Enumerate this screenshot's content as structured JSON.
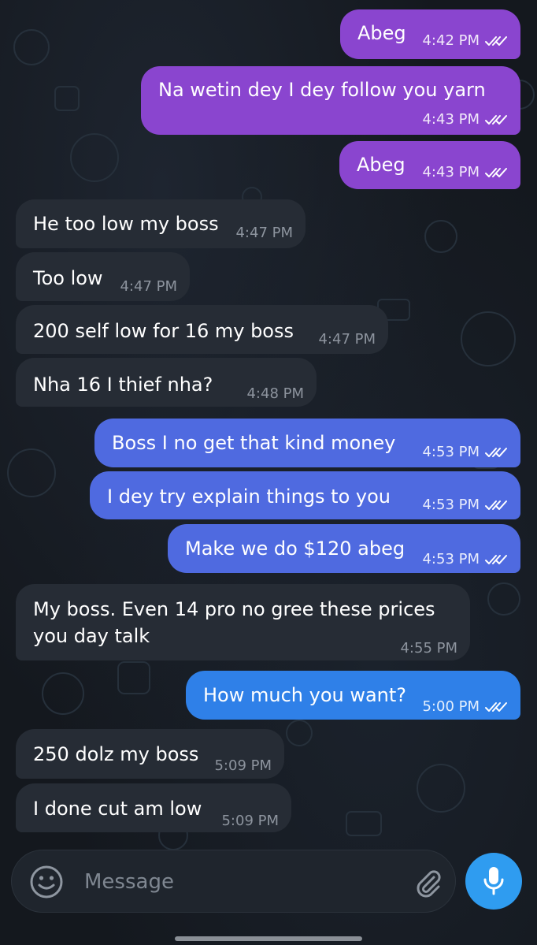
{
  "theme": {
    "outgoing_purple": "#8a45cf",
    "outgoing_blue": "#4f6ae0",
    "outgoing_sky": "#2f80e8",
    "incoming": "#262c35",
    "accent": "#2f9cf0"
  },
  "messages": [
    {
      "dir": "out",
      "text": "Abeg",
      "time": "4:42 PM",
      "read": true
    },
    {
      "dir": "out",
      "text": "Na wetin dey I dey follow you yarn",
      "time": "4:43 PM",
      "read": true
    },
    {
      "dir": "out",
      "text": "Abeg",
      "time": "4:43 PM",
      "read": true
    },
    {
      "dir": "in",
      "text": "He too low my boss",
      "time": "4:47 PM"
    },
    {
      "dir": "in",
      "text": "Too low",
      "time": "4:47 PM"
    },
    {
      "dir": "in",
      "text": "200 self low for 16 my boss",
      "time": "4:47 PM"
    },
    {
      "dir": "in",
      "text": "Nha 16 I thief nha?",
      "time": "4:48 PM"
    },
    {
      "dir": "out",
      "text": "Boss I no get that kind money",
      "time": "4:53 PM",
      "read": true
    },
    {
      "dir": "out",
      "text": "I dey try explain things to you",
      "time": "4:53 PM",
      "read": true
    },
    {
      "dir": "out",
      "text": "Make we do $120 abeg",
      "time": "4:53 PM",
      "read": true
    },
    {
      "dir": "in",
      "text": "My boss. Even 14 pro no gree these prices",
      "text2": "you day talk",
      "time": "4:55 PM"
    },
    {
      "dir": "out",
      "text": "How much you want?",
      "time": "5:00 PM",
      "read": true
    },
    {
      "dir": "in",
      "text": "250 dolz my boss",
      "time": "5:09 PM"
    },
    {
      "dir": "in",
      "text": "I done cut am low",
      "time": "5:09 PM"
    }
  ],
  "composer": {
    "placeholder": "Message",
    "emoji_icon": "emoji-icon",
    "attach_icon": "paperclip-icon",
    "mic_icon": "microphone-icon"
  }
}
